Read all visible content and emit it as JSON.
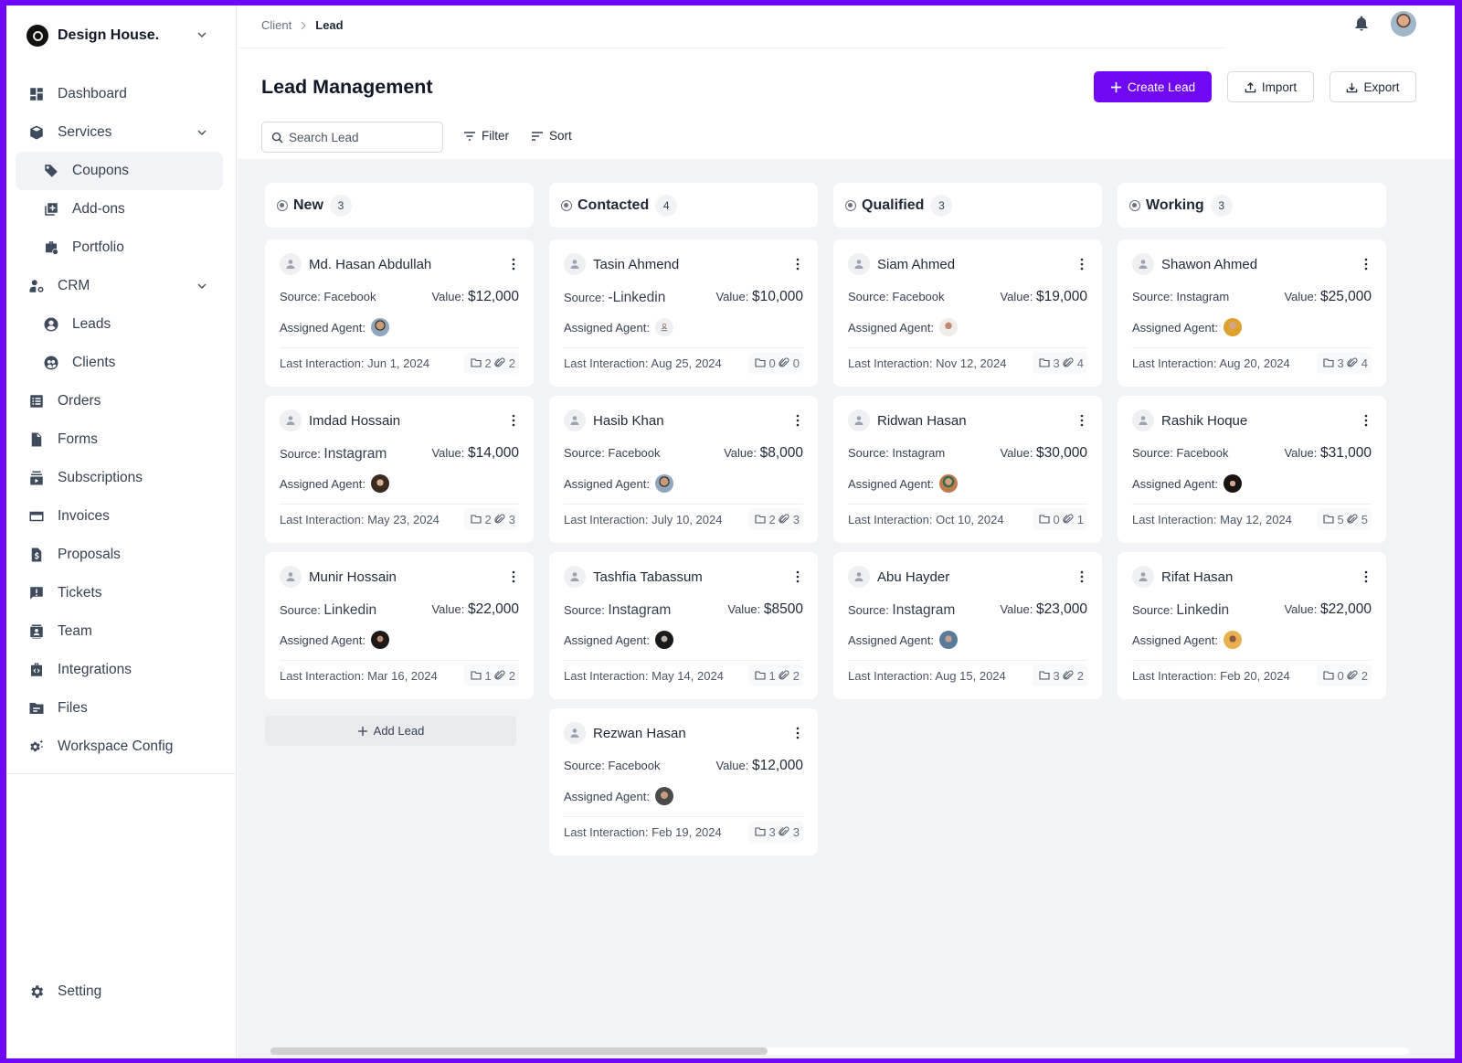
{
  "brand": {
    "name": "Design House."
  },
  "sidebar": {
    "items": [
      {
        "label": "Dashboard",
        "icon": "dashboard-icon"
      },
      {
        "label": "Services",
        "icon": "box-icon",
        "expandable": true
      },
      {
        "label": "Coupons",
        "icon": "tag-icon",
        "sub": true,
        "active": true
      },
      {
        "label": "Add-ons",
        "icon": "add-box-icon",
        "sub": true
      },
      {
        "label": "Portfolio",
        "icon": "briefcase-icon",
        "sub": true
      },
      {
        "label": "CRM",
        "icon": "user-gear-icon",
        "expandable": true
      },
      {
        "label": "Leads",
        "icon": "user-circle-icon",
        "sub": true
      },
      {
        "label": "Clients",
        "icon": "users-circle-icon",
        "sub": true
      },
      {
        "label": "Orders",
        "icon": "list-icon"
      },
      {
        "label": "Forms",
        "icon": "document-icon"
      },
      {
        "label": "Subscriptions",
        "icon": "subscriptions-icon"
      },
      {
        "label": "Invoices",
        "icon": "credit-card-icon"
      },
      {
        "label": "Proposals",
        "icon": "dollar-document-icon"
      },
      {
        "label": "Tickets",
        "icon": "alert-message-icon"
      },
      {
        "label": "Team",
        "icon": "contact-icon"
      },
      {
        "label": "Integrations",
        "icon": "code-bag-icon"
      },
      {
        "label": "Files",
        "icon": "folder-icon"
      },
      {
        "label": "Workspace Config",
        "icon": "gear-sparkle-icon"
      }
    ],
    "setting": "Setting"
  },
  "breadcrumb": {
    "parent": "Client",
    "current": "Lead"
  },
  "header": {
    "title": "Lead Management",
    "create_label": "Create Lead",
    "import_label": "Import",
    "export_label": "Export",
    "search_placeholder": "Search Lead",
    "filter_label": "Filter",
    "sort_label": "Sort"
  },
  "colors": {
    "accent": "#7008f5",
    "background": "#f1f3f7"
  },
  "columns": [
    {
      "title": "New",
      "count": "3",
      "cards": [
        {
          "name": "Md. Hasan Abdullah",
          "source": "Facebook",
          "value": "$12,000",
          "last": "Jun 1, 2024",
          "files": "2",
          "attachments": "2",
          "agent": "a1"
        },
        {
          "name": "Imdad Hossain",
          "source": "Instagram",
          "value": "$14,000",
          "last": "May 23, 2024",
          "files": "2",
          "attachments": "3",
          "agent": "a2",
          "bigsrc": true
        },
        {
          "name": "Munir Hossain",
          "source": "Linkedin",
          "value": "$22,000",
          "last": "Mar 16, 2024",
          "files": "1",
          "attachments": "2",
          "agent": "a3",
          "bigsrc": true
        }
      ],
      "add_label": "Add Lead"
    },
    {
      "title": "Contacted",
      "count": "4",
      "cards": [
        {
          "name": "Tasin Ahmend",
          "source": "-Linkedin",
          "value": "$10,000",
          "last": "Aug 25, 2024",
          "files": "0",
          "attachments": "0",
          "agent": "none",
          "bigsrc": true
        },
        {
          "name": "Hasib Khan",
          "source": "Facebook",
          "value": "$8,000",
          "last": "July 10, 2024",
          "files": "2",
          "attachments": "3",
          "agent": "a1"
        },
        {
          "name": "Tashfia Tabassum",
          "source": "Instagram",
          "value": "$8500",
          "last": "May 14, 2024",
          "files": "1",
          "attachments": "2",
          "agent": "a4",
          "bigsrc": true
        },
        {
          "name": "Rezwan Hasan",
          "source": "Facebook",
          "value": "$12,000",
          "last": "Feb 19, 2024",
          "files": "3",
          "attachments": "3",
          "agent": "a5"
        }
      ]
    },
    {
      "title": "Qualified",
      "count": "3",
      "cards": [
        {
          "name": "Siam Ahmed",
          "source": "Facebook",
          "value": "$19,000",
          "last": "Nov 12, 2024",
          "files": "3",
          "attachments": "4",
          "agent": "a6"
        },
        {
          "name": "Ridwan Hasan",
          "source": "Instagram",
          "value": "$30,000",
          "last": "Oct 10, 2024",
          "files": "0",
          "attachments": "1",
          "agent": "a7"
        },
        {
          "name": "Abu Hayder",
          "source": "Instagram",
          "value": "$23,000",
          "last": "Aug 15, 2024",
          "files": "3",
          "attachments": "2",
          "agent": "a8",
          "bigsrc": true
        }
      ]
    },
    {
      "title": "Working",
      "count": "3",
      "cards": [
        {
          "name": "Shawon Ahmed",
          "source": "Instagram",
          "value": "$25,000",
          "last": "Aug 20, 2024",
          "files": "3",
          "attachments": "4",
          "agent": "a9"
        },
        {
          "name": "Rashik Hoque",
          "source": "Facebook",
          "value": "$31,000",
          "last": "May 12, 2024",
          "files": "5",
          "attachments": "5",
          "agent": "a10"
        },
        {
          "name": "Rifat Hasan",
          "source": "Linkedin",
          "value": "$22,000",
          "last": "Feb 20, 2024",
          "files": "0",
          "attachments": "2",
          "agent": "a11",
          "bigsrc": true
        }
      ]
    }
  ],
  "labels": {
    "source": "Source: ",
    "value": "Value: ",
    "agent": "Assigned Agent:",
    "last": "Last Interaction: "
  }
}
